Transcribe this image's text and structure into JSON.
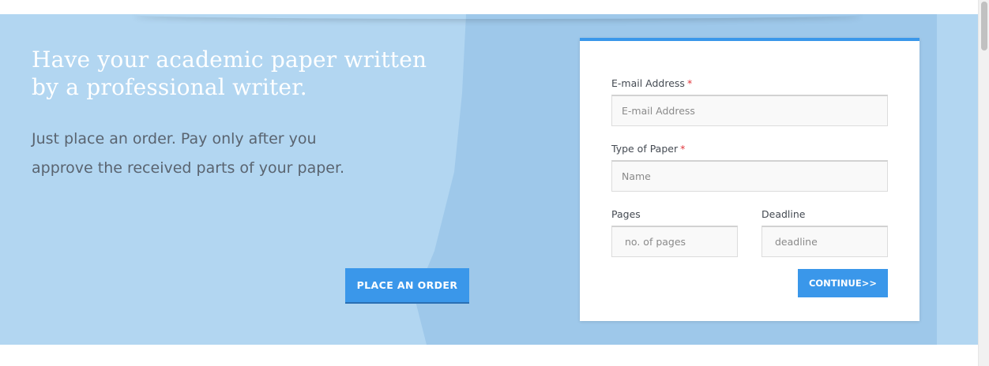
{
  "hero": {
    "headline": "Have your academic paper written by a professional writer.",
    "subtext": "Just place an order. Pay only after you approve the received parts of your paper.",
    "order_button_label": "PLACE AN ORDER"
  },
  "form": {
    "email": {
      "label": "E-mail Address",
      "required_mark": "*",
      "placeholder": "E-mail Address",
      "value": ""
    },
    "paper_type": {
      "label": "Type of Paper",
      "required_mark": "*",
      "placeholder": "Name",
      "value": ""
    },
    "pages": {
      "label": "Pages",
      "placeholder": "no. of pages",
      "value": ""
    },
    "deadline": {
      "label": "Deadline",
      "placeholder": "deadline",
      "value": ""
    },
    "continue_label": "CONTINUE>>"
  },
  "colors": {
    "hero_light": "#b2d6f1",
    "hero_dark": "#9dc7ea",
    "accent": "#3a97ea",
    "required": "#e0353b"
  }
}
